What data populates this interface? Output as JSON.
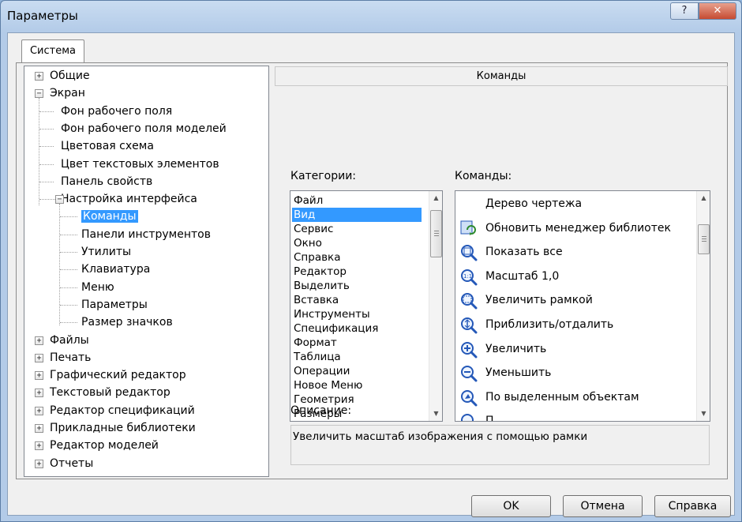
{
  "window": {
    "title": "Параметры",
    "help_glyph": "?",
    "close_glyph": "✕"
  },
  "tab": {
    "label": "Система"
  },
  "tree": {
    "items": [
      {
        "label": "Общие",
        "expander": "+"
      },
      {
        "label": "Экран",
        "expander": "−"
      },
      {
        "label": "Фон рабочего поля"
      },
      {
        "label": "Фон рабочего поля моделей"
      },
      {
        "label": "Цветовая схема"
      },
      {
        "label": "Цвет текстовых элементов"
      },
      {
        "label": "Панель свойств"
      },
      {
        "label": "Настройка интерфейса",
        "expander": "−"
      },
      {
        "label": "Команды",
        "selected": true
      },
      {
        "label": "Панели инструментов"
      },
      {
        "label": "Утилиты"
      },
      {
        "label": "Клавиатура"
      },
      {
        "label": "Меню"
      },
      {
        "label": "Параметры"
      },
      {
        "label": "Размер значков"
      },
      {
        "label": "Файлы",
        "expander": "+"
      },
      {
        "label": "Печать",
        "expander": "+"
      },
      {
        "label": "Графический редактор",
        "expander": "+"
      },
      {
        "label": "Текстовый редактор",
        "expander": "+"
      },
      {
        "label": "Редактор спецификаций",
        "expander": "+"
      },
      {
        "label": "Прикладные библиотеки",
        "expander": "+"
      },
      {
        "label": "Редактор моделей",
        "expander": "+"
      },
      {
        "label": "Отчеты",
        "expander": "+"
      }
    ]
  },
  "panel": {
    "header": "Команды",
    "categories_label": "Категории:",
    "commands_label": "Команды:",
    "description_label": "Описание:",
    "description": "Увеличить масштаб изображения с помощью рамки"
  },
  "categories": [
    "Файл",
    "Вид",
    "Сервис",
    "Окно",
    "Справка",
    "Редактор",
    "Выделить",
    "Вставка",
    "Инструменты",
    "Спецификация",
    "Формат",
    "Таблица",
    "Операции",
    "Новое Меню",
    "Геометрия",
    "Размеры"
  ],
  "categories_selected": "Вид",
  "commands": [
    {
      "label": "Дерево чертежа",
      "icon": "none"
    },
    {
      "label": "Обновить менеджер библиотек",
      "icon": "refresh-library-icon"
    },
    {
      "label": "Показать все",
      "icon": "zoom-all-icon"
    },
    {
      "label": "Масштаб 1,0",
      "icon": "zoom-1to1-icon"
    },
    {
      "label": "Увеличить рамкой",
      "icon": "zoom-frame-icon"
    },
    {
      "label": "Приблизить/отдалить",
      "icon": "zoom-dynamic-icon"
    },
    {
      "label": "Увеличить",
      "icon": "zoom-in-icon"
    },
    {
      "label": "Уменьшить",
      "icon": "zoom-out-icon"
    },
    {
      "label": "По выделенным объектам",
      "icon": "zoom-selection-icon"
    },
    {
      "label": "П...",
      "icon": "zoom-icon"
    }
  ],
  "buttons": {
    "ok": "OK",
    "cancel": "Отмена",
    "help": "Справка"
  },
  "colors": {
    "selection": "#3399ff",
    "titlebar": "#b3cbe8",
    "close": "#c64b32"
  }
}
